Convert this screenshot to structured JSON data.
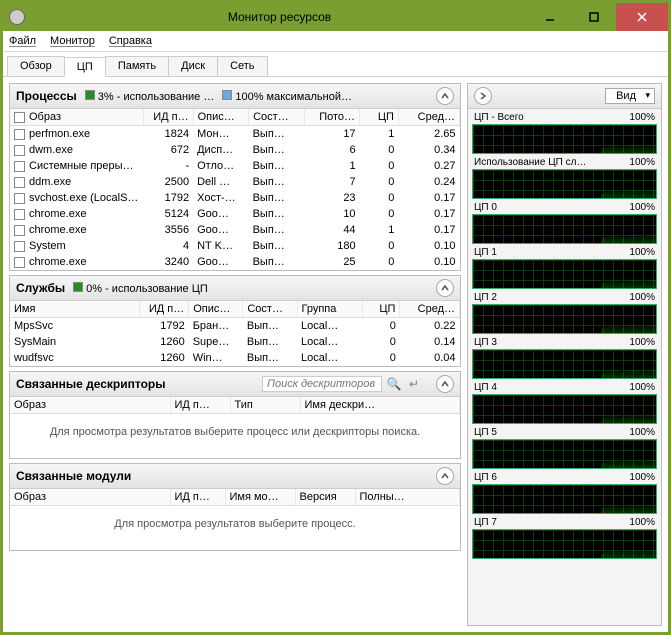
{
  "window": {
    "title": "Монитор ресурсов"
  },
  "menu": {
    "file": "Файл",
    "monitor": "Монитор",
    "help": "Справка"
  },
  "tabs": [
    {
      "label": "Обзор",
      "active": false
    },
    {
      "label": "ЦП",
      "active": true
    },
    {
      "label": "Память",
      "active": false
    },
    {
      "label": "Диск",
      "active": false
    },
    {
      "label": "Сеть",
      "active": false
    }
  ],
  "processes": {
    "title": "Процессы",
    "stat1": "3% - использование …",
    "stat1_color": "#2a8a2a",
    "stat2": "100% максимальной…",
    "stat2_color": "#6aa8e8",
    "columns": [
      "Образ",
      "ИД п…",
      "Опис…",
      "Сост…",
      "Пото…",
      "ЦП",
      "Сред…"
    ],
    "rows": [
      {
        "img": "perfmon.exe",
        "pid": "1824",
        "desc": "Мон…",
        "state": "Вып…",
        "thr": "17",
        "cpu": "1",
        "avg": "2.65"
      },
      {
        "img": "dwm.exe",
        "pid": "672",
        "desc": "Дисп…",
        "state": "Вып…",
        "thr": "6",
        "cpu": "0",
        "avg": "0.34"
      },
      {
        "img": "Системные преры…",
        "pid": "-",
        "desc": "Отло…",
        "state": "Вып…",
        "thr": "1",
        "cpu": "0",
        "avg": "0.27"
      },
      {
        "img": "ddm.exe",
        "pid": "2500",
        "desc": "Dell …",
        "state": "Вып…",
        "thr": "7",
        "cpu": "0",
        "avg": "0.24"
      },
      {
        "img": "svchost.exe (LocalS…",
        "pid": "1792",
        "desc": "Хост-…",
        "state": "Вып…",
        "thr": "23",
        "cpu": "0",
        "avg": "0.17"
      },
      {
        "img": "chrome.exe",
        "pid": "5124",
        "desc": "Goo…",
        "state": "Вып…",
        "thr": "10",
        "cpu": "0",
        "avg": "0.17"
      },
      {
        "img": "chrome.exe",
        "pid": "3556",
        "desc": "Goo…",
        "state": "Вып…",
        "thr": "44",
        "cpu": "1",
        "avg": "0.17"
      },
      {
        "img": "System",
        "pid": "4",
        "desc": "NT K…",
        "state": "Вып…",
        "thr": "180",
        "cpu": "0",
        "avg": "0.10"
      },
      {
        "img": "chrome.exe",
        "pid": "3240",
        "desc": "Goo…",
        "state": "Вып…",
        "thr": "25",
        "cpu": "0",
        "avg": "0.10"
      }
    ]
  },
  "services": {
    "title": "Службы",
    "stat": "0% - использование ЦП",
    "stat_color": "#2a8a2a",
    "columns": [
      "Имя",
      "ИД п…",
      "Опис…",
      "Сост…",
      "Группа",
      "ЦП",
      "Сред…"
    ],
    "rows": [
      {
        "name": "MpsSvc",
        "pid": "1792",
        "desc": "Бран…",
        "state": "Вып…",
        "grp": "Local…",
        "cpu": "0",
        "avg": "0.22"
      },
      {
        "name": "SysMain",
        "pid": "1260",
        "desc": "Supe…",
        "state": "Вып…",
        "grp": "Local…",
        "cpu": "0",
        "avg": "0.14"
      },
      {
        "name": "wudfsvc",
        "pid": "1260",
        "desc": "Win…",
        "state": "Вып…",
        "grp": "Local…",
        "cpu": "0",
        "avg": "0.04"
      }
    ]
  },
  "handles": {
    "title": "Связанные дескрипторы",
    "search_placeholder": "Поиск дескрипторов",
    "columns": [
      "Образ",
      "ИД п…",
      "Тип",
      "Имя дескри…"
    ],
    "placeholder": "Для просмотра результатов выберите процесс или дескрипторы поиска."
  },
  "modules": {
    "title": "Связанные модули",
    "columns": [
      "Образ",
      "ИД п…",
      "Имя мо…",
      "Версия",
      "Полны…"
    ],
    "placeholder": "Для просмотра результатов выберите процесс."
  },
  "right": {
    "view_label": "Вид",
    "graphs": [
      {
        "label": "ЦП - Всего",
        "pct": "100%"
      },
      {
        "label": "Использование ЦП сл…",
        "pct": "100%"
      },
      {
        "label": "ЦП 0",
        "pct": "100%"
      },
      {
        "label": "ЦП 1",
        "pct": "100%"
      },
      {
        "label": "ЦП 2",
        "pct": "100%"
      },
      {
        "label": "ЦП 3",
        "pct": "100%"
      },
      {
        "label": "ЦП 4",
        "pct": "100%"
      },
      {
        "label": "ЦП 5",
        "pct": "100%"
      },
      {
        "label": "ЦП 6",
        "pct": "100%"
      },
      {
        "label": "ЦП 7",
        "pct": "100%"
      }
    ]
  }
}
